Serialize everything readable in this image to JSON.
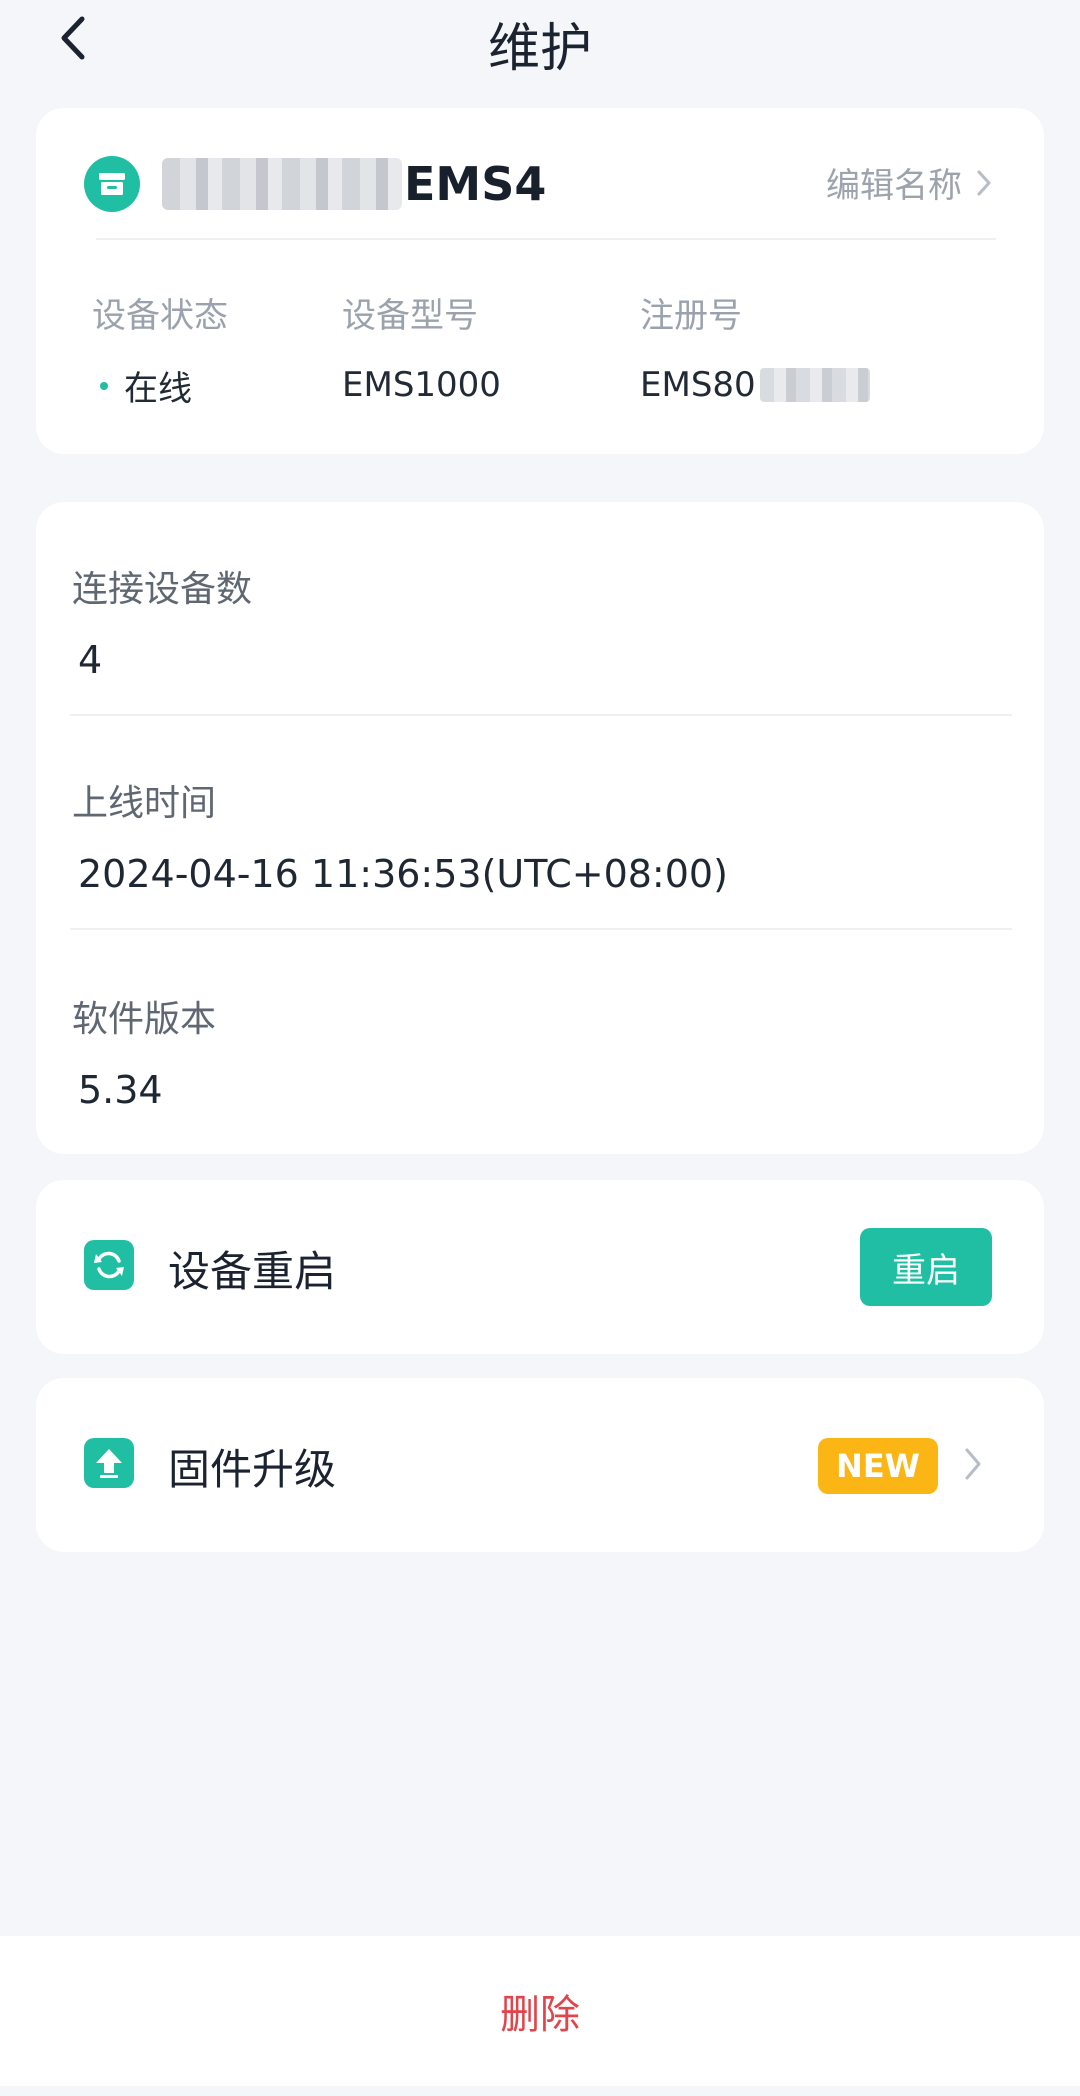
{
  "header": {
    "title": "维护"
  },
  "device": {
    "name_suffix": "EMS4",
    "edit_name_label": "编辑名称",
    "status": {
      "label": "设备状态",
      "value": "在线"
    },
    "model": {
      "label": "设备型号",
      "value": "EMS1000"
    },
    "registration": {
      "label": "注册号",
      "value_prefix": "EMS80"
    }
  },
  "details": {
    "connected_devices": {
      "label": "连接设备数",
      "value": "4"
    },
    "online_time": {
      "label": "上线时间",
      "value": "2024-04-16 11:36:53(UTC+08:00)"
    },
    "software_version": {
      "label": "软件版本",
      "value": "5.34"
    }
  },
  "restart": {
    "label": "设备重启",
    "button_label": "重启"
  },
  "upgrade": {
    "label": "固件升级",
    "badge": "NEW"
  },
  "footer": {
    "delete_label": "删除"
  },
  "colors": {
    "accent": "#20bfa4",
    "badge": "#fbb514",
    "danger": "#e1444a"
  }
}
